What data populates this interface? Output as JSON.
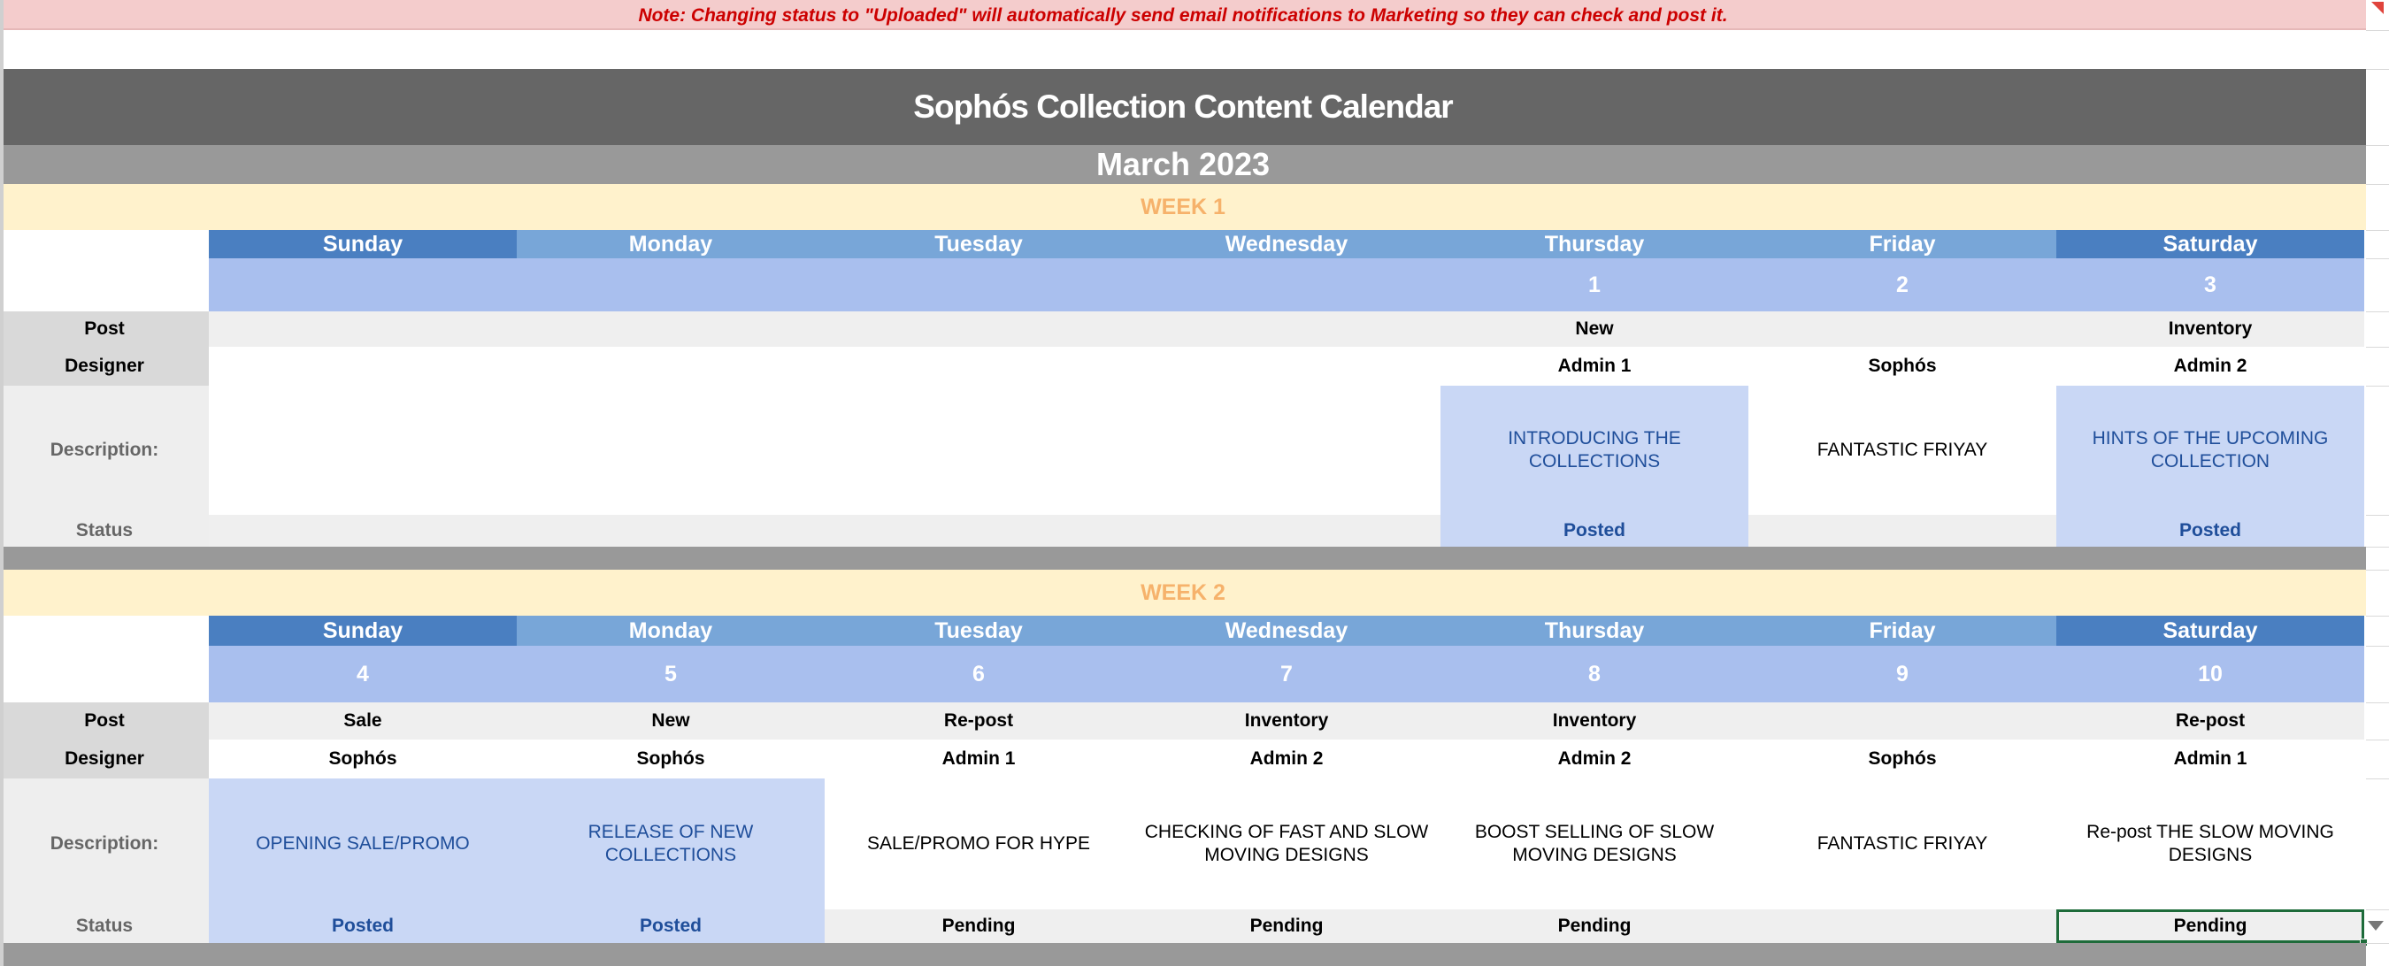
{
  "note": "Note: Changing status to \"Uploaded\" will automatically send email notifications to Marketing so they can check and post it.",
  "title": "Sophós Collection Content Calendar",
  "month": "March 2023",
  "labels": {
    "post": "Post",
    "designer": "Designer",
    "description": "Description:",
    "status": "Status"
  },
  "colors": {
    "header_dark": "#666666",
    "month_bar": "#999999",
    "week_bar": "#fff2cc",
    "week_text": "#f6b26b",
    "day_selected": "#4a7fc1",
    "day_header": "#78a6d8",
    "date_row": "#a9bfee",
    "highlight_cell": "#c9d7f5",
    "status_blue": "#1f4e9a",
    "note_bg": "#f4cccc",
    "note_text": "#cc0000"
  },
  "weeks": [
    {
      "label": "WEEK 1",
      "days": [
        {
          "name": "Sunday",
          "date": "",
          "post": "",
          "designer": "",
          "description": "",
          "status": "",
          "highlight": false
        },
        {
          "name": "Monday",
          "date": "",
          "post": "",
          "designer": "",
          "description": "",
          "status": "",
          "highlight": false
        },
        {
          "name": "Tuesday",
          "date": "",
          "post": "",
          "designer": "",
          "description": "",
          "status": "",
          "highlight": false
        },
        {
          "name": "Wednesday",
          "date": "",
          "post": "",
          "designer": "",
          "description": "",
          "status": "",
          "highlight": false
        },
        {
          "name": "Thursday",
          "date": "1",
          "post": "New",
          "designer": "Admin 1",
          "description": "INTRODUCING THE COLLECTIONS",
          "status": "Posted",
          "highlight": true
        },
        {
          "name": "Friday",
          "date": "2",
          "post": "",
          "designer": "Sophós",
          "description": "FANTASTIC FRIYAY",
          "status": "",
          "highlight": false
        },
        {
          "name": "Saturday",
          "date": "3",
          "post": "Inventory",
          "designer": "Admin 2",
          "description": "HINTS OF THE UPCOMING COLLECTION",
          "status": "Posted",
          "highlight": true
        }
      ]
    },
    {
      "label": "WEEK 2",
      "days": [
        {
          "name": "Sunday",
          "date": "4",
          "post": "Sale",
          "designer": "Sophós",
          "description": "OPENING SALE/PROMO",
          "status": "Posted",
          "highlight": true
        },
        {
          "name": "Monday",
          "date": "5",
          "post": "New",
          "designer": "Sophós",
          "description": "RELEASE OF NEW COLLECTIONS",
          "status": "Posted",
          "highlight": true
        },
        {
          "name": "Tuesday",
          "date": "6",
          "post": "Re-post",
          "designer": "Admin 1",
          "description": "SALE/PROMO FOR HYPE",
          "status": "Pending",
          "highlight": false
        },
        {
          "name": "Wednesday",
          "date": "7",
          "post": "Inventory",
          "designer": "Admin 2",
          "description": "CHECKING OF FAST AND SLOW MOVING DESIGNS",
          "status": "Pending",
          "highlight": false
        },
        {
          "name": "Thursday",
          "date": "8",
          "post": "Inventory",
          "designer": "Admin 2",
          "description": "BOOST SELLING OF SLOW MOVING DESIGNS",
          "status": "Pending",
          "highlight": false
        },
        {
          "name": "Friday",
          "date": "9",
          "post": "",
          "designer": "Sophós",
          "description": "FANTASTIC FRIYAY",
          "status": "",
          "highlight": false
        },
        {
          "name": "Saturday",
          "date": "10",
          "post": "Re-post",
          "designer": "Admin 1",
          "description": "Re-post THE SLOW MOVING DESIGNS",
          "status": "Pending",
          "highlight": false
        }
      ]
    }
  ]
}
